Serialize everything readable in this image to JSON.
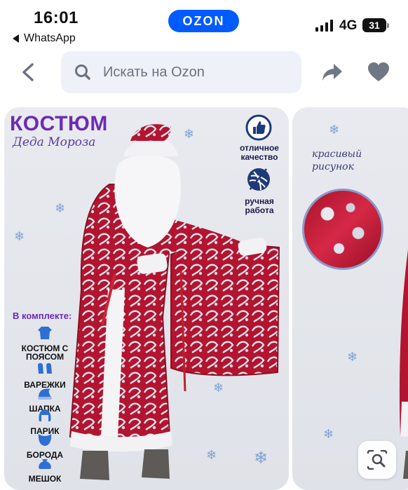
{
  "status_bar": {
    "time": "16:01",
    "back_app": "WhatsApp",
    "network": "4G",
    "battery": "31"
  },
  "header": {
    "brand": "OZON",
    "brand_color": "#005bff",
    "search_placeholder": "Искать на Ozon",
    "icons": [
      "back-arrow-icon",
      "search-icon",
      "share-icon",
      "heart-icon"
    ]
  },
  "product_image": {
    "title_line1": "КОСТЮМ",
    "title_line2": "Деда Мороза",
    "features": [
      {
        "label": "отличное качество",
        "icon": "thumbs-up-icon"
      },
      {
        "label": "ручная работа",
        "icon": "yarn-icon"
      }
    ],
    "kit": {
      "heading": "В комплекте:",
      "items": [
        {
          "label": "КОСТЮМ С ПОЯСОМ",
          "icon": "coat-icon"
        },
        {
          "label": "ВАРЕЖКИ",
          "icon": "mittens-icon"
        },
        {
          "label": "ШАПКА",
          "icon": "hat-icon"
        },
        {
          "label": "ПАРИК",
          "icon": "wig-icon"
        },
        {
          "label": "БОРОДА",
          "icon": "beard-icon"
        },
        {
          "label": "МЕШОК",
          "icon": "sack-icon"
        }
      ]
    },
    "accent_color": "#6c2bb5",
    "costume_color": "#b3142f"
  },
  "second_image": {
    "caption": "красивый рисунок"
  },
  "image_search_button": {
    "icon": "image-search-icon"
  }
}
